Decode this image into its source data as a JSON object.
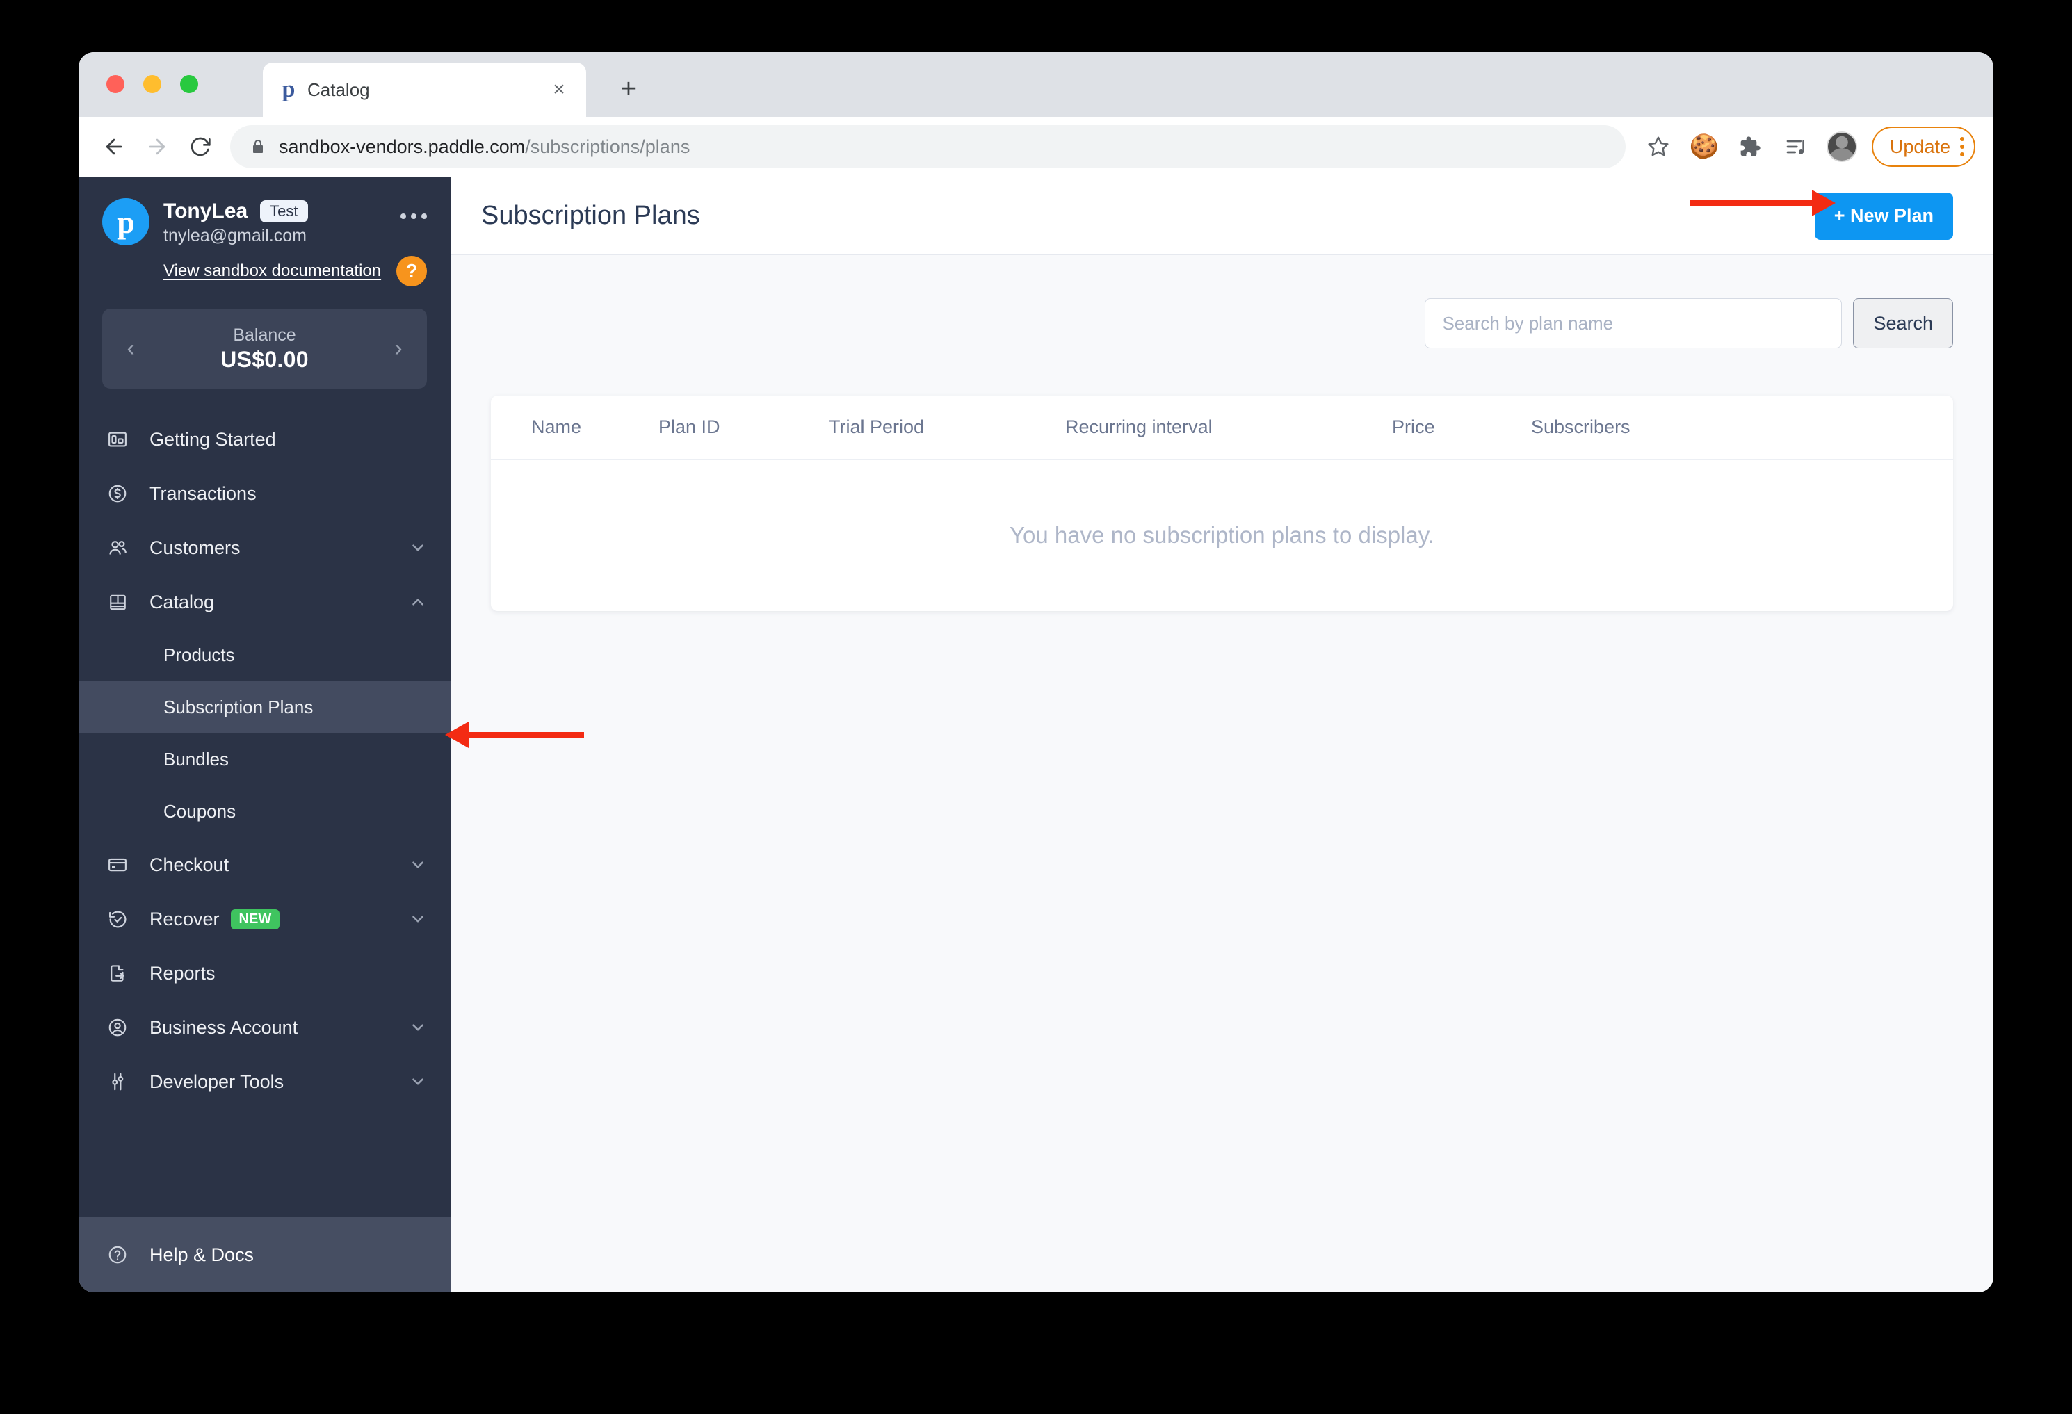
{
  "browser": {
    "tab": {
      "title": "Catalog",
      "favicon": "paddle-logo-icon",
      "close_label": "×"
    },
    "new_tab_label": "+",
    "nav": {
      "back": "back-icon",
      "forward": "forward-icon",
      "reload": "reload-icon"
    },
    "omnibox": {
      "secure_icon": "lock-icon",
      "url_host": "sandbox-vendors.paddle.com",
      "url_path": "/subscriptions/plans"
    },
    "actions": {
      "bookmark": "star-icon",
      "cookie": "🍪",
      "extensions": "puzzle-icon",
      "media": "media-list-icon",
      "profile": "avatar-icon",
      "update_label": "Update",
      "menu": "kebab-menu-icon"
    }
  },
  "sidebar": {
    "account": {
      "logo_letter": "p",
      "name": "TonyLea",
      "mode_badge": "Test",
      "email": "tnylea@gmail.com",
      "overflow": "more-options-icon",
      "doc_link": "View sandbox documentation",
      "help_badge": "?"
    },
    "balance": {
      "prev": "‹",
      "label": "Balance",
      "value": "US$0.00",
      "next": "›"
    },
    "items": [
      {
        "label": "Getting Started",
        "icon": "dashboard-icon",
        "expandable": false,
        "active": false
      },
      {
        "label": "Transactions",
        "icon": "dollar-circle-icon",
        "expandable": false,
        "active": false
      },
      {
        "label": "Customers",
        "icon": "users-icon",
        "expandable": true,
        "expanded": false,
        "active": false
      },
      {
        "label": "Catalog",
        "icon": "catalog-grid-icon",
        "expandable": true,
        "expanded": true,
        "active": false
      }
    ],
    "catalog_children": [
      {
        "label": "Products",
        "active": false
      },
      {
        "label": "Subscription Plans",
        "active": true
      },
      {
        "label": "Bundles",
        "active": false
      },
      {
        "label": "Coupons",
        "active": false
      }
    ],
    "items_after": [
      {
        "label": "Checkout",
        "icon": "credit-card-icon",
        "expandable": true,
        "badge": "",
        "active": false
      },
      {
        "label": "Recover",
        "icon": "recover-clock-icon",
        "expandable": true,
        "badge": "NEW",
        "active": false
      },
      {
        "label": "Reports",
        "icon": "report-export-icon",
        "expandable": false,
        "badge": "",
        "active": false
      },
      {
        "label": "Business Account",
        "icon": "user-circle-icon",
        "expandable": true,
        "badge": "",
        "active": false
      },
      {
        "label": "Developer Tools",
        "icon": "sliders-icon",
        "expandable": true,
        "badge": "",
        "active": false
      }
    ],
    "footer": {
      "label": "Help  &  Docs",
      "icon": "question-circle-icon"
    }
  },
  "main": {
    "title": "Subscription Plans",
    "new_plan_button": "+ New Plan",
    "search": {
      "placeholder": "Search by plan name",
      "value": "",
      "button_label": "Search"
    },
    "table": {
      "columns": [
        "Name",
        "Plan ID",
        "Trial Period",
        "Recurring interval",
        "Price",
        "Subscribers"
      ],
      "rows": [],
      "empty_message": "You have no subscription plans to display."
    }
  },
  "annotations": {
    "arrow_new_plan": "red-arrow-pointing-to-new-plan-button",
    "arrow_subscription_plans": "red-arrow-pointing-to-subscription-plans-nav"
  },
  "colors": {
    "sidebar_bg": "#2b3346",
    "sidebar_active": "#434b60",
    "accent_blue": "#0d96f2",
    "badge_new_green": "#3fc45f",
    "annotation_red": "#f32b13",
    "update_orange": "#d9730d"
  }
}
